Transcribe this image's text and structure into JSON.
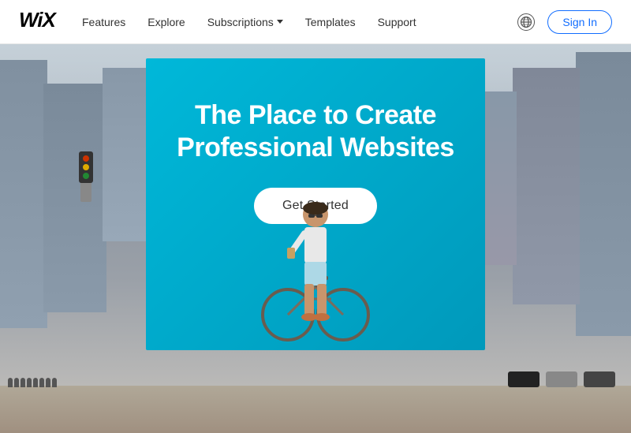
{
  "navbar": {
    "logo": "Wix",
    "nav_items": [
      {
        "label": "Features",
        "has_dropdown": false
      },
      {
        "label": "Explore",
        "has_dropdown": false
      },
      {
        "label": "Subscriptions",
        "has_dropdown": true
      },
      {
        "label": "Templates",
        "has_dropdown": false
      },
      {
        "label": "Support",
        "has_dropdown": false
      }
    ],
    "globe_label": "Language selector",
    "sign_in_label": "Sign In"
  },
  "hero": {
    "title_line1": "The Place to Create",
    "title_line2": "Professional Websites",
    "cta_button": "Get Started"
  }
}
